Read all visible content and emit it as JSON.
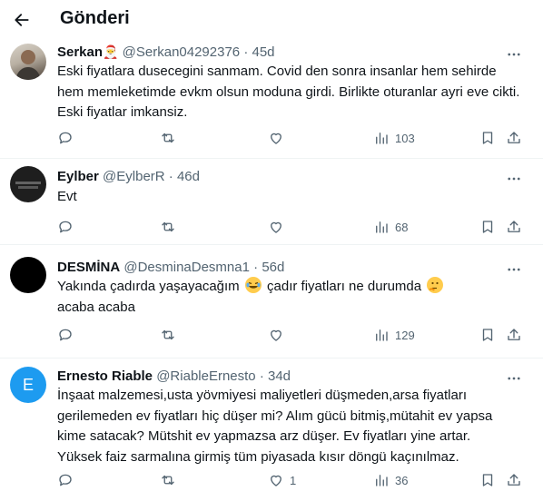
{
  "header": {
    "title": "Gönderi",
    "back_icon": "arrow-left-icon"
  },
  "replies": [
    {
      "name": "Serkan",
      "name_emoji": "🎅",
      "handle": "@Serkan04292376",
      "dot": "·",
      "time": "45d",
      "text": "Eski fiyatlara dusecegini sanmam. Covid den sonra insanlar hem sehirde hem memleketimde evkm olsun moduna girdi. Birlikte oturanlar ayri eve cikti. Eski fiyatlar imkansiz.",
      "views": "103",
      "likes": ""
    },
    {
      "name": "Eylber",
      "handle": "@EylberR",
      "dot": "·",
      "time": "46d",
      "text": "Evt",
      "views": "68",
      "likes": ""
    },
    {
      "name": "DESMİNA",
      "handle": "@DesminaDesmna1",
      "dot": "·",
      "time": "56d",
      "text_part1": "Yakında çadırda yaşayacağım",
      "text_part2": "çadır fiyatları ne durumda",
      "text_part3": "acaba acaba",
      "views": "129",
      "likes": ""
    },
    {
      "name": "Ernesto Riable",
      "handle": "@RiableErnesto",
      "dot": "·",
      "time": "34d",
      "avatar_letter": "E",
      "text": "İnşaat malzemesi,usta yövmiyesi maliyetleri düşmeden,arsa fiyatları gerilemeden ev fiyatları hiç düşer mi? Alım gücü bitmiş,mütahit ev yapsa kime satacak? Mütshit ev yapmazsa arz düşer. Ev fiyatları yine artar. Yüksek faiz sarmalına girmiş tüm piyasada kısır döngü kaçınılmaz.",
      "views": "36",
      "likes": "1"
    }
  ],
  "colors": {
    "text": "#0f1419",
    "secondary": "#536471",
    "divider": "#eff3f4",
    "avatar_e": "#1d9bf0"
  }
}
